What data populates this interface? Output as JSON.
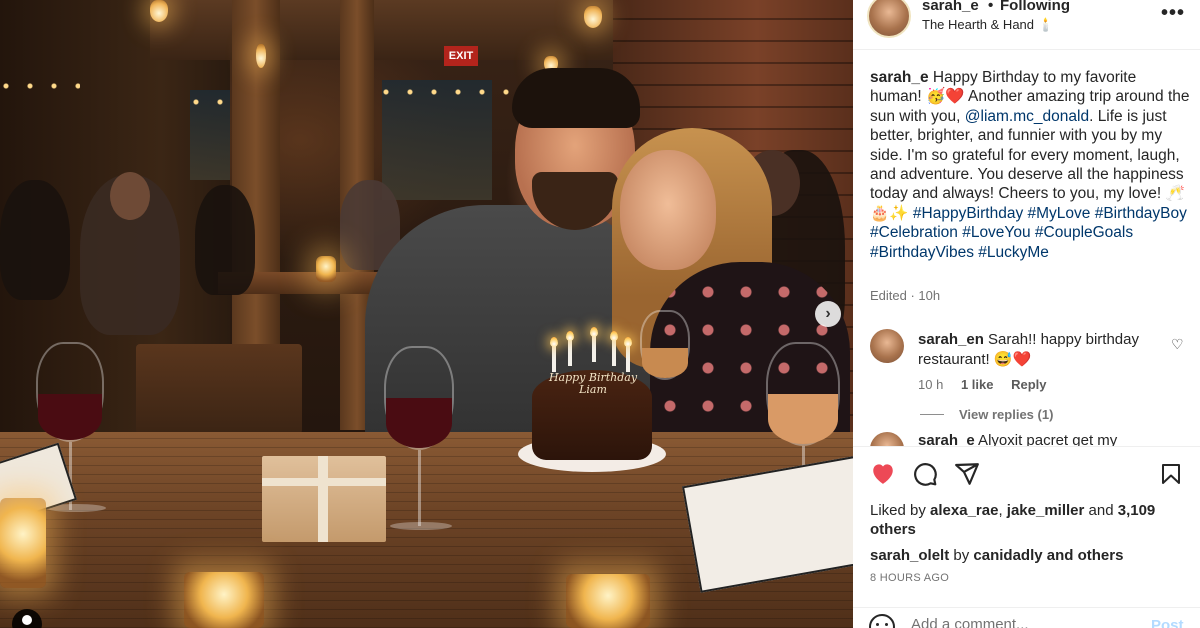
{
  "post": {
    "username": "sarah_e",
    "follow_status": "Following",
    "location": "The Hearth & Hand 🕯️",
    "more_icon": "more-horizontal-icon"
  },
  "photo": {
    "cake_text": "Happy Birthday Liam",
    "exit_sign": "EXIT",
    "next_icon": "chevron-right-icon"
  },
  "caption": {
    "username": "sarah_e",
    "text_part1": " Happy Birthday to my favorite human! 🥳❤️ Another amazing trip around the sun with you, ",
    "mention": "@liam.mc_donald",
    "text_part2": ". Life is just better, brighter, and funnier with you by my side. I'm so grateful for every moment, laugh, and adventure. You deserve all the happiness today and always! Cheers to you, my love! 🥂🎂✨ ",
    "hashtags": "#HappyBirthday #MyLove #BirthdayBoy #Celebration #LoveYou #CoupleGoals #BirthdayVibes #LuckyMe",
    "edited": "Edited · 10h"
  },
  "comments": [
    {
      "username": "sarah_en",
      "text": " Sarah!! happy birthday restaurant! 😅❤️",
      "time": "10 h",
      "likes": "1 like",
      "reply": "Reply",
      "view_replies": "View replies (1)"
    },
    {
      "username": "sarah_e",
      "text": " Alyoxit pacret get my"
    }
  ],
  "actions": {
    "like_icon": "heart-filled-icon",
    "comment_icon": "comment-icon",
    "share_icon": "send-icon",
    "save_icon": "bookmark-icon",
    "liked_prefix": "Liked by ",
    "liked_user1": "alexa_rae",
    "liked_sep": ", ",
    "liked_user2": "jake_miller",
    "liked_and": " and ",
    "liked_count": "3,109 others",
    "liked2_user": "sarah_olelt",
    "liked2_by": " by ",
    "liked2_user2": "canidadly",
    "liked2_tail": " and others",
    "time": "8 HOURS AGO"
  },
  "add_comment": {
    "placeholder": "Add a comment...",
    "post_label": "Post"
  },
  "colors": {
    "like_red": "#ed4956",
    "link_blue": "#00376b",
    "post_disabled": "#b3dbff"
  }
}
